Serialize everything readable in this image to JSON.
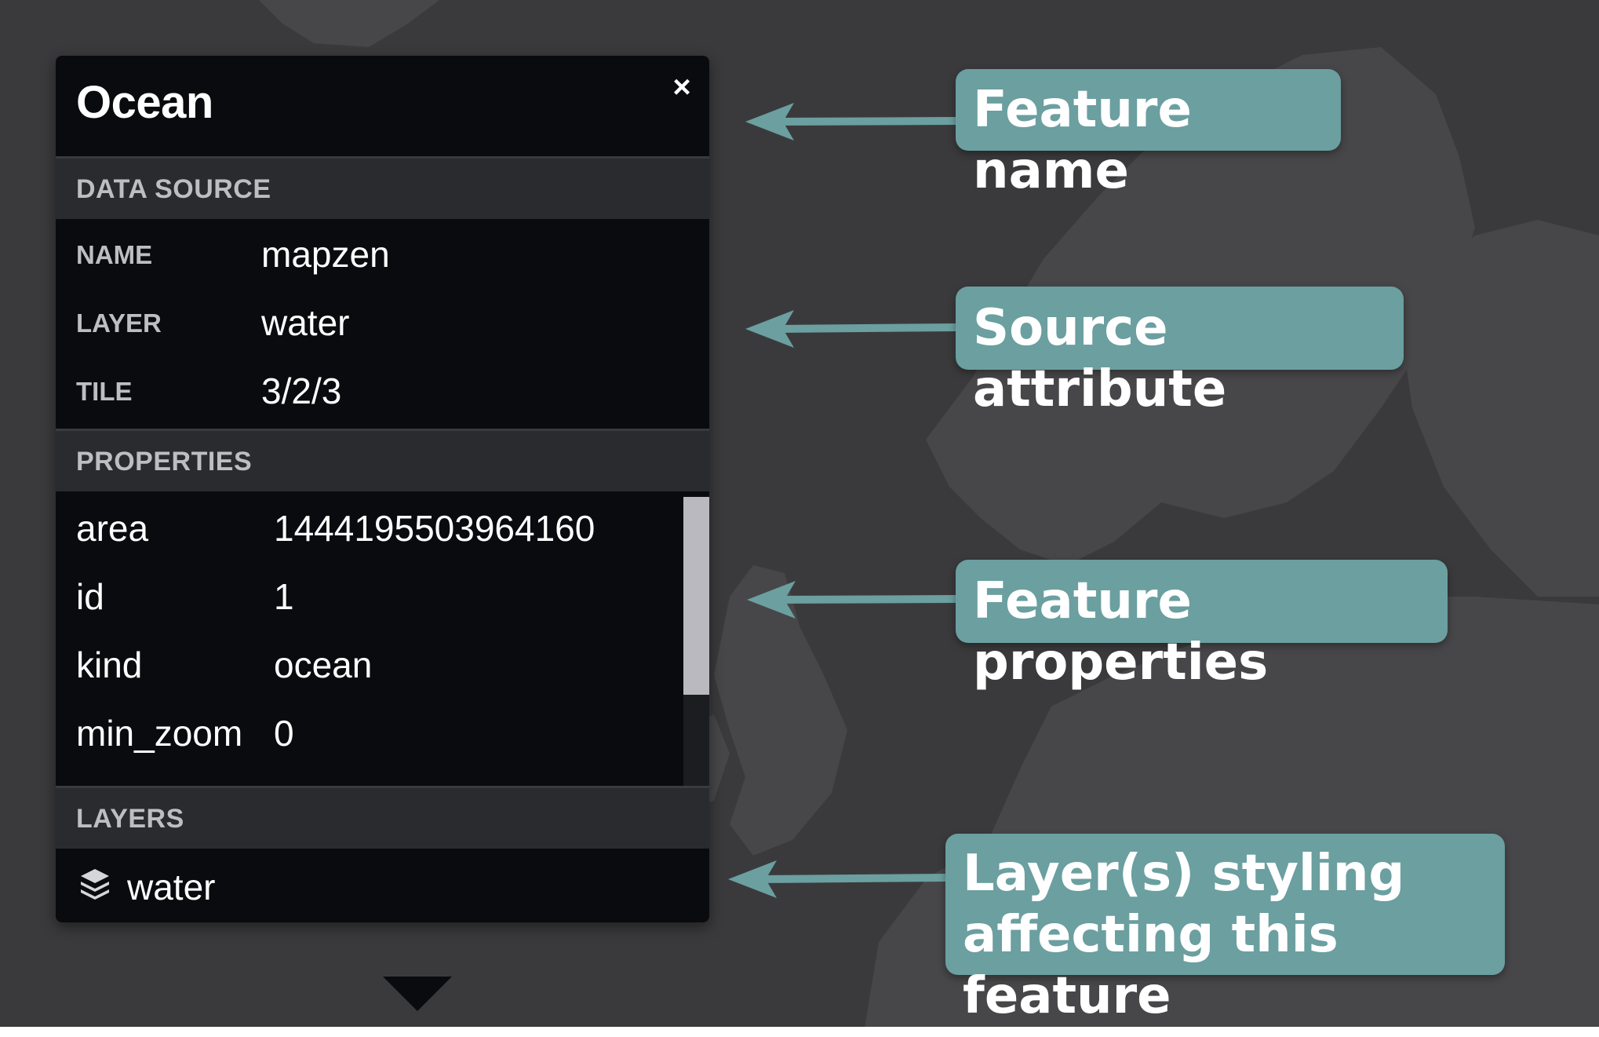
{
  "popup": {
    "title": "Ocean",
    "close_label": "×",
    "data_source": {
      "heading": "DATA SOURCE",
      "rows": [
        {
          "label": "NAME",
          "value": "mapzen"
        },
        {
          "label": "LAYER",
          "value": "water"
        },
        {
          "label": "TILE",
          "value": "3/2/3"
        }
      ]
    },
    "properties": {
      "heading": "PROPERTIES",
      "rows": [
        {
          "key": "area",
          "value": "1444195503964160"
        },
        {
          "key": "id",
          "value": "1"
        },
        {
          "key": "kind",
          "value": "ocean"
        },
        {
          "key": "min_zoom",
          "value": "0"
        }
      ]
    },
    "layers": {
      "heading": "LAYERS",
      "items": [
        {
          "name": "water",
          "icon": "layers-icon"
        }
      ]
    }
  },
  "callouts": {
    "feature_name": "Feature name",
    "source_attribute": "Source attribute",
    "feature_properties": "Feature properties",
    "layer_styling_line1": "Layer(s) styling",
    "layer_styling_line2": "affecting this feature"
  },
  "colors": {
    "map_background": "#3a3a3c",
    "land": "#474749",
    "popup_background": "#0a0b0e",
    "section_header": "#2a2b2f",
    "callout": "#6b9fa0"
  }
}
